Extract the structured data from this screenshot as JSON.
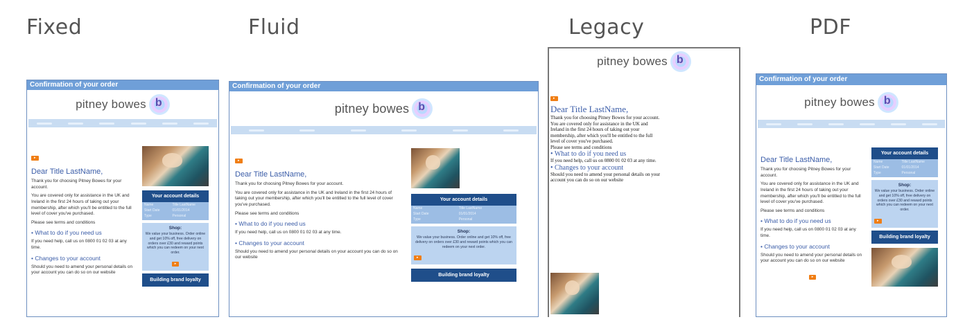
{
  "titles": [
    "Fixed",
    "Fluid",
    "Legacy",
    "PDF"
  ],
  "email": {
    "header": "Confirmation of your order",
    "brand": "pitney bowes",
    "greeting": "Dear Title LastName,",
    "thanks": "Thank you for choosing Pitney Bowes for your account.",
    "cover": "You are covered only for assistance in the UK and Ireland in the first 24 hours of taking out your membership, after which you'll be entitled to the full level of cover you've purchased.",
    "terms": "Please see terms and conditions",
    "help_title": "What to do if you need us",
    "help_text": "If you need help, call us on 0800 01 02 03 at any time.",
    "changes_title": "Changes to your account",
    "changes_text": "Should you need to amend your personal details on your account you can do so on our website",
    "account_title": "Your account details",
    "account_rows": [
      {
        "label": "Name",
        "value": "Title LastName"
      },
      {
        "label": "Start Date",
        "value": "01/01/2014"
      },
      {
        "label": "Type",
        "value": "Personal"
      }
    ],
    "shop_title": "Shop:",
    "shop_text": "We value your business. Order online and get 10% off, free delivery on orders over £30 and reward points which you can redeem on your next order.",
    "brand_loyalty": "Building brand loyalty"
  }
}
